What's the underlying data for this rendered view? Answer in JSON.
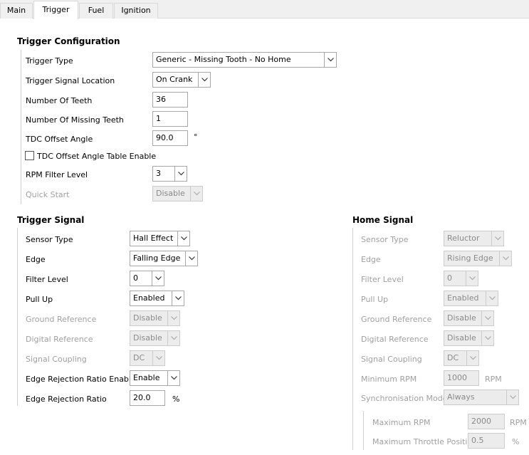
{
  "tabs": [
    {
      "label": "Main",
      "active": false
    },
    {
      "label": "Trigger",
      "active": true
    },
    {
      "label": "Fuel",
      "active": false
    },
    {
      "label": "Ignition",
      "active": false
    }
  ],
  "trigger_config": {
    "title": "Trigger Configuration",
    "trigger_type": {
      "label": "Trigger Type",
      "value": "Generic - Missing Tooth - No Home"
    },
    "signal_location": {
      "label": "Trigger Signal Location",
      "value": "On Crank"
    },
    "num_teeth": {
      "label": "Number Of Teeth",
      "value": "36"
    },
    "num_missing": {
      "label": "Number Of Missing Teeth",
      "value": "1"
    },
    "tdc_offset": {
      "label": "TDC Offset Angle",
      "value": "90.0",
      "unit": "°"
    },
    "tdc_table_enable": {
      "label": "TDC Offset Angle Table Enable",
      "checked": false
    },
    "rpm_filter": {
      "label": "RPM Filter Level",
      "value": "3"
    },
    "quick_start": {
      "label": "Quick Start",
      "value": "Disable"
    }
  },
  "trigger_signal": {
    "title": "Trigger Signal",
    "sensor_type": {
      "label": "Sensor Type",
      "value": "Hall Effect"
    },
    "edge": {
      "label": "Edge",
      "value": "Falling Edge"
    },
    "filter_level": {
      "label": "Filter Level",
      "value": "0"
    },
    "pull_up": {
      "label": "Pull Up",
      "value": "Enabled"
    },
    "ground_ref": {
      "label": "Ground Reference",
      "value": "Disable"
    },
    "digital_ref": {
      "label": "Digital Reference",
      "value": "Disable"
    },
    "coupling": {
      "label": "Signal Coupling",
      "value": "DC"
    },
    "edge_rej_enable": {
      "label": "Edge Rejection Ratio Enable",
      "value": "Enable"
    },
    "edge_rej_ratio": {
      "label": "Edge Rejection Ratio",
      "value": "20.0",
      "unit": "%"
    }
  },
  "home_signal": {
    "title": "Home Signal",
    "sensor_type": {
      "label": "Sensor Type",
      "value": "Reluctor"
    },
    "edge": {
      "label": "Edge",
      "value": "Rising Edge"
    },
    "filter_level": {
      "label": "Filter Level",
      "value": "0"
    },
    "pull_up": {
      "label": "Pull Up",
      "value": "Enabled"
    },
    "ground_ref": {
      "label": "Ground Reference",
      "value": "Disable"
    },
    "digital_ref": {
      "label": "Digital Reference",
      "value": "Disable"
    },
    "coupling": {
      "label": "Signal Coupling",
      "value": "DC"
    },
    "min_rpm": {
      "label": "Minimum RPM",
      "value": "1000",
      "unit": "RPM"
    },
    "sync_mode": {
      "label": "Synchronisation Mode",
      "value": "Always"
    },
    "max_rpm": {
      "label": "Maximum RPM",
      "value": "2000",
      "unit": "RPM"
    },
    "max_throttle": {
      "label": "Maximum Throttle Position",
      "value": "0.5",
      "unit": "%"
    }
  }
}
